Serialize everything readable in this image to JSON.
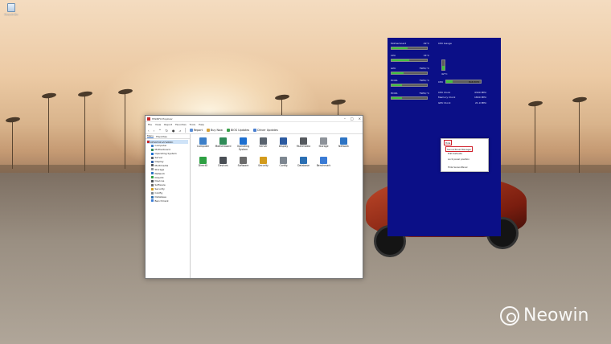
{
  "desktop": {
    "recycle_bin_label": "Recycle Bin"
  },
  "window": {
    "title": "HWiNFO Explorer",
    "menu": [
      "File",
      "View",
      "Report",
      "Favorites",
      "Tools",
      "Help"
    ],
    "toolbar": {
      "report": "Report",
      "buy_now": "Buy Now",
      "bios_updates": "BIOS Updates",
      "driver_updates": "Driver Updates"
    },
    "tabs": [
      "Menu",
      "Favorites"
    ],
    "tree_root": "DESKTOP-Z7G8IDC",
    "tree_items": [
      "Computer",
      "Motherboard",
      "Operating System",
      "Server",
      "Display",
      "Multimedia",
      "Storage",
      "Network",
      "DirectX",
      "Devices",
      "Software",
      "Security",
      "Config",
      "Database",
      "Benchmark"
    ],
    "grid_items": [
      {
        "label": "Computer",
        "color": "#3c7fc8"
      },
      {
        "label": "Motherboard",
        "color": "#2f8b57"
      },
      {
        "label": "Operating System",
        "color": "#1d6fd0"
      },
      {
        "label": "Server",
        "color": "#59636e"
      },
      {
        "label": "Display",
        "color": "#2c5aa0"
      },
      {
        "label": "Multimedia",
        "color": "#55595e"
      },
      {
        "label": "Storage",
        "color": "#8d9299"
      },
      {
        "label": "Network",
        "color": "#2d74c4"
      },
      {
        "label": "DirectX",
        "color": "#2ea043"
      },
      {
        "label": "Devices",
        "color": "#4a4f55"
      },
      {
        "label": "Software",
        "color": "#6b6b6b"
      },
      {
        "label": "Security",
        "color": "#d39b1c"
      },
      {
        "label": "Config",
        "color": "#7d8690"
      },
      {
        "label": "Database",
        "color": "#2b6fb3"
      },
      {
        "label": "Benchmark",
        "color": "#3a7bd5"
      }
    ]
  },
  "gadget": {
    "sensors": [
      {
        "name": "Motherboard",
        "value": "29°C",
        "level": 0.45
      },
      {
        "name": "CPU",
        "value": "33°C",
        "level": 0.5
      },
      {
        "name": "GPU",
        "value": "TSEN,°C",
        "level": 0.35
      },
      {
        "name": "HDD1",
        "value": "TSEN,°C",
        "level": 0.3
      },
      {
        "name": "HDD1",
        "value": "TSEN,°C",
        "level": 0.3
      }
    ],
    "cpu_gauge_title": "CPU Gauge",
    "cpu_gauge_level": 0.45,
    "cpu_temp": "42°C",
    "cpu_usage_label": "CPU",
    "cpu_usage_value": "BAN 3070",
    "cpu_usage_level": 0.18,
    "clocks": [
      {
        "name": "CPU Clock",
        "value": "4300 MHz"
      },
      {
        "name": "Memory Clock",
        "value": "1800 MHz"
      },
      {
        "name": "GPU Clock",
        "value": "21.9 MHz"
      }
    ],
    "context_menu": [
      "Hide",
      "SensorPanel Manager",
      "Edit Defaults",
      "Lock panel position",
      "Hide SensorPanel"
    ]
  },
  "watermark": "Neowin"
}
